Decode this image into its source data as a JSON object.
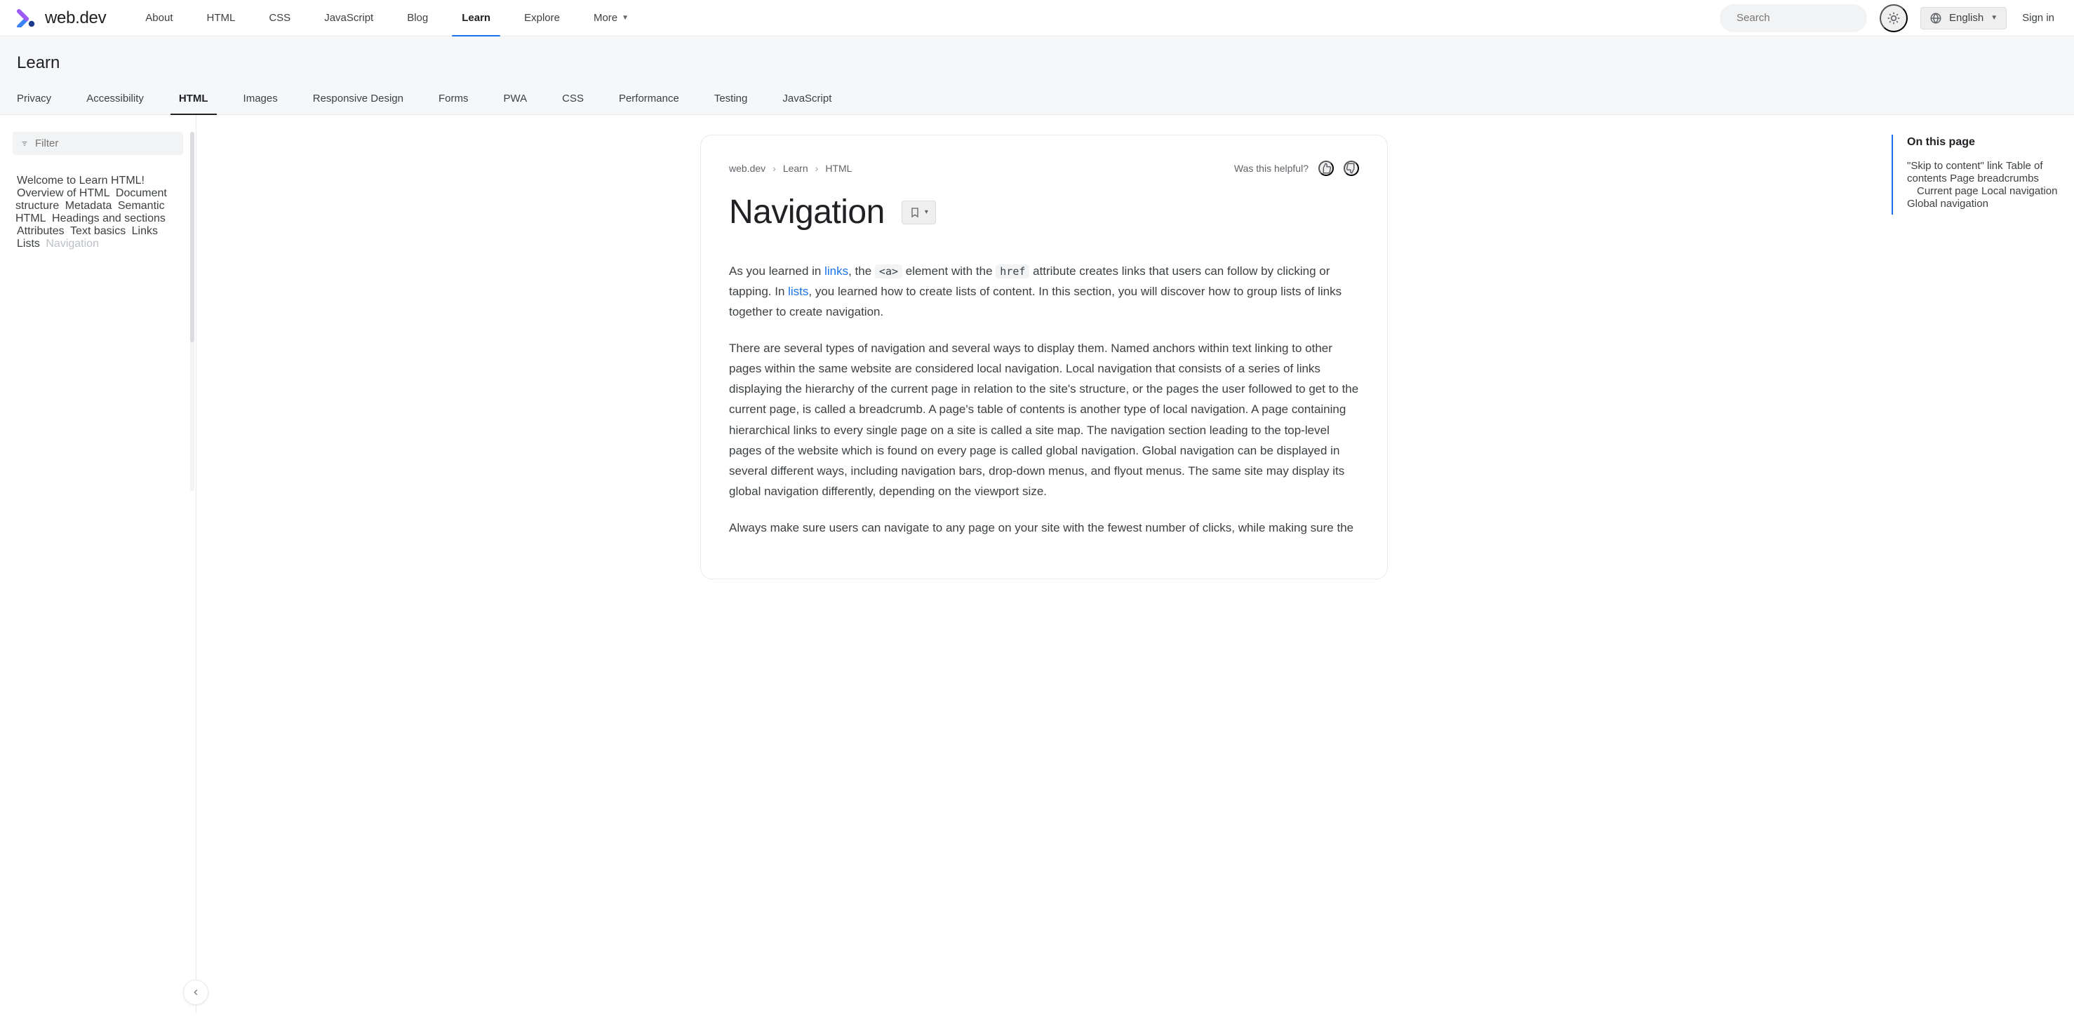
{
  "brand": {
    "name": "web.dev"
  },
  "topnav": {
    "about": "About",
    "html": "HTML",
    "css": "CSS",
    "js": "JavaScript",
    "blog": "Blog",
    "learn": "Learn",
    "explore": "Explore",
    "more": "More"
  },
  "search": {
    "placeholder": "Search",
    "key": "/"
  },
  "language": {
    "label": "English"
  },
  "signin": "Sign in",
  "subheader": {
    "title": "Learn",
    "tabs": {
      "privacy": "Privacy",
      "a11y": "Accessibility",
      "html": "HTML",
      "images": "Images",
      "responsive": "Responsive Design",
      "forms": "Forms",
      "pwa": "PWA",
      "css": "CSS",
      "perf": "Performance",
      "testing": "Testing",
      "jsc": "JavaScript"
    }
  },
  "sidebar": {
    "filter_placeholder": "Filter",
    "items": [
      "Welcome to Learn HTML!",
      "Overview of HTML",
      "Document structure",
      "Metadata",
      "Semantic HTML",
      "Headings and sections",
      "Attributes",
      "Text basics",
      "Links",
      "Lists",
      "Navigation"
    ]
  },
  "breadcrumbs": {
    "a": "web.dev",
    "b": "Learn",
    "c": "HTML"
  },
  "helpful": {
    "q": "Was this helpful?"
  },
  "page": {
    "title": "Navigation",
    "p1a": "As you learned in ",
    "p1_link1": "links",
    "p1b": ", the ",
    "p1_code1": "<a>",
    "p1c": " element with the ",
    "p1_code2": "href",
    "p1d": " attribute creates links that users can follow by clicking or tapping. In ",
    "p1_link2": "lists",
    "p1e": ", you learned how to create lists of content. In this section, you will discover how to group lists of links together to create navigation.",
    "p2": "There are several types of navigation and several ways to display them. Named anchors within text linking to other pages within the same website are considered local navigation. Local navigation that consists of a series of links displaying the hierarchy of the current page in relation to the site's structure, or the pages the user followed to get to the current page, is called a breadcrumb. A page's table of contents is another type of local navigation. A page containing hierarchical links to every single page on a site is called a site map. The navigation section leading to the top-level pages of the website which is found on every page is called global navigation. Global navigation can be displayed in several different ways, including navigation bars, drop-down menus, and flyout menus. The same site may display its global navigation differently, depending on the viewport size.",
    "p3": "Always make sure users can navigate to any page on your site with the fewest number of clicks, while making sure the"
  },
  "toc": {
    "title": "On this page",
    "i1": "\"Skip to content\" link",
    "i2": "Table of contents",
    "i3": "Page breadcrumbs",
    "i3a": "Current page",
    "i4": "Local navigation",
    "i5": "Global navigation"
  }
}
